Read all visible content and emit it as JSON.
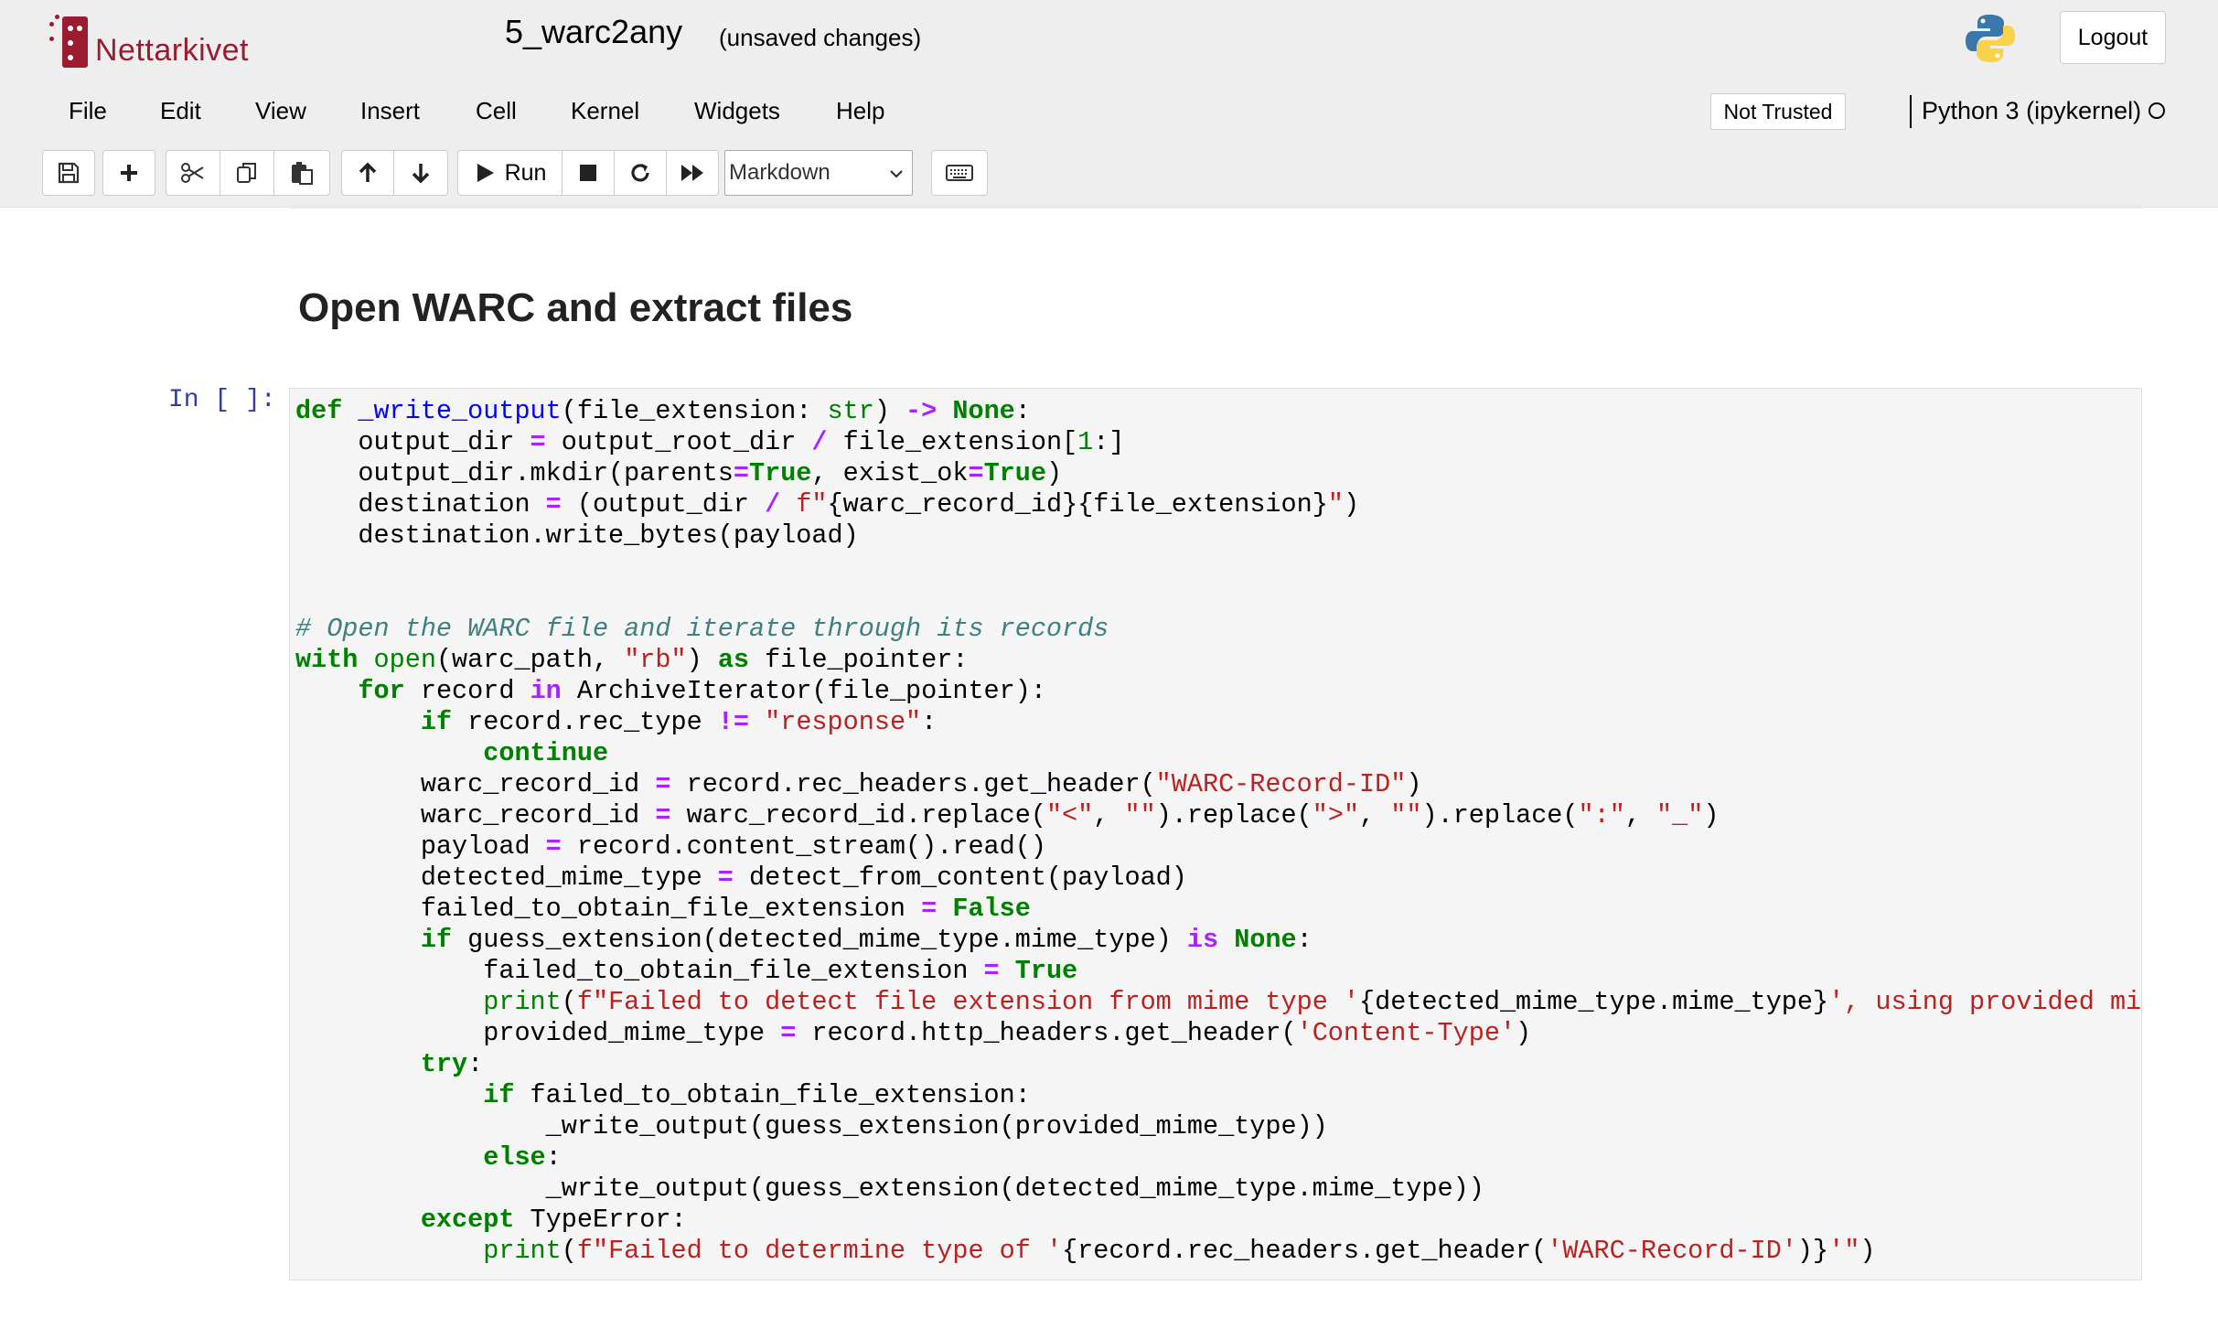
{
  "header": {
    "logo_text": "Nettarkivet",
    "notebook_title": "5_warc2any",
    "save_status": "(unsaved changes)",
    "logout_label": "Logout"
  },
  "menu": {
    "items": [
      "File",
      "Edit",
      "View",
      "Insert",
      "Cell",
      "Kernel",
      "Widgets",
      "Help"
    ],
    "trust_label": "Not Trusted",
    "kernel_name": "Python 3 (ipykernel)"
  },
  "toolbar": {
    "run_label": "Run",
    "cell_type": "Markdown",
    "icons": [
      "save-icon",
      "plus-icon",
      "scissors-icon",
      "copy-icon",
      "paste-icon",
      "arrow-up-icon",
      "arrow-down-icon",
      "play-icon",
      "stop-icon",
      "restart-icon",
      "fast-forward-icon",
      "keyboard-icon"
    ]
  },
  "notebook": {
    "markdown_heading": "Open WARC and extract files",
    "cell_prompt": "In [ ]:",
    "code_lines": [
      "def _write_output(file_extension: str) -> None:",
      "    output_dir = output_root_dir / file_extension[1:]",
      "    output_dir.mkdir(parents=True, exist_ok=True)",
      "    destination = (output_dir / f\"{warc_record_id}{file_extension}\")",
      "    destination.write_bytes(payload)",
      "",
      "",
      "# Open the WARC file and iterate through its records",
      "with open(warc_path, \"rb\") as file_pointer:",
      "    for record in ArchiveIterator(file_pointer):",
      "        if record.rec_type != \"response\":",
      "            continue",
      "        warc_record_id = record.rec_headers.get_header(\"WARC-Record-ID\")",
      "        warc_record_id = warc_record_id.replace(\"<\", \"\").replace(\">\", \"\").replace(\":\", \"_\")",
      "        payload = record.content_stream().read()",
      "        detected_mime_type = detect_from_content(payload)",
      "        failed_to_obtain_file_extension = False",
      "        if guess_extension(detected_mime_type.mime_type) is None:",
      "            failed_to_obtain_file_extension = True",
      "            print(f\"Failed to detect file extension from mime type '{detected_mime_type.mime_type}', using provided mime",
      "            provided_mime_type = record.http_headers.get_header('Content-Type')",
      "        try:",
      "            if failed_to_obtain_file_extension:",
      "                _write_output(guess_extension(provided_mime_type))",
      "            else:",
      "                _write_output(guess_extension(detected_mime_type.mime_type))",
      "        except TypeError:",
      "            print(f\"Failed to determine type of '{record.rec_headers.get_header('WARC-Record-ID')}'\")"
    ]
  },
  "colors": {
    "brand": "#9b1b30",
    "keyword": "#008000",
    "operator": "#aa22ff",
    "string": "#ba2121",
    "comment": "#408080",
    "function_name": "#0000ff",
    "prompt": "#303f9f"
  }
}
